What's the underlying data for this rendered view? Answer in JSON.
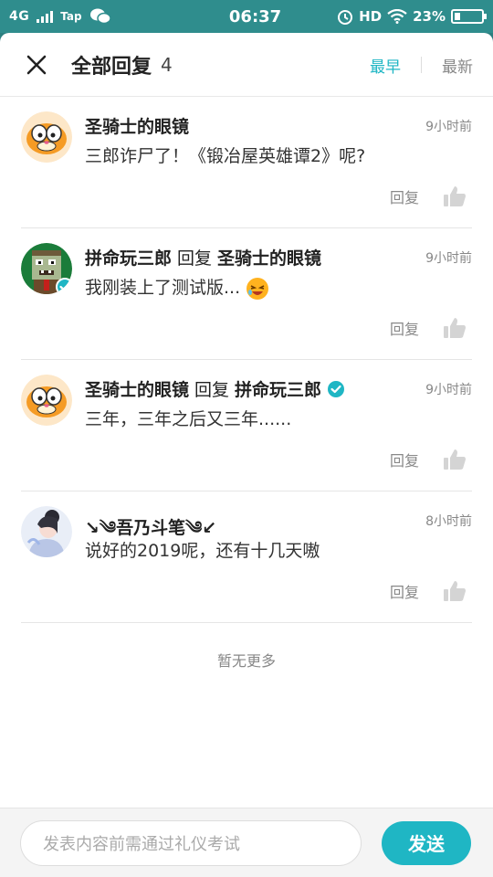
{
  "status_bar": {
    "network": "4G",
    "app_label": "Tap",
    "time": "06:37",
    "hd_label": "HD",
    "battery_text": "23%",
    "battery_level": 0.23
  },
  "header": {
    "title": "全部回复",
    "count": "4",
    "sort_earliest": "最早",
    "sort_latest": "最新"
  },
  "comments": [
    {
      "author": "圣骑士的眼镜",
      "reply_word": "",
      "reply_to": "",
      "time": "9小时前",
      "content": "三郎诈尸了！《锻冶屋英雄谭2》呢?",
      "reply_label": "回复",
      "avatar_icon": "garfield-avatar-icon"
    },
    {
      "author": "拼命玩三郎",
      "reply_word": "回复",
      "reply_to": "圣骑士的眼镜",
      "time": "9小时前",
      "content": "我刚装上了测试版...",
      "reply_label": "回复",
      "avatar_icon": "zombie-avatar-icon"
    },
    {
      "author": "圣骑士的眼镜",
      "reply_word": "回复",
      "reply_to": "拼命玩三郎",
      "time": "9小时前",
      "content": "三年，三年之后又三年......",
      "reply_label": "回复",
      "avatar_icon": "garfield-avatar-icon"
    },
    {
      "author": "↘༄吾乃斗笔༄↙",
      "reply_word": "",
      "reply_to": "",
      "time": "8小时前",
      "content": "说好的2019呢，还有十几天嗷",
      "reply_label": "回复",
      "avatar_icon": "girl-avatar-icon"
    }
  ],
  "no_more_text": "暂无更多",
  "input": {
    "placeholder": "发表内容前需通过礼仪考试"
  },
  "send_label": "发送",
  "colors": {
    "accent": "#1fb6c4",
    "status_bar_bg": "#2f8d8d",
    "verified": "#1fb6c4"
  }
}
